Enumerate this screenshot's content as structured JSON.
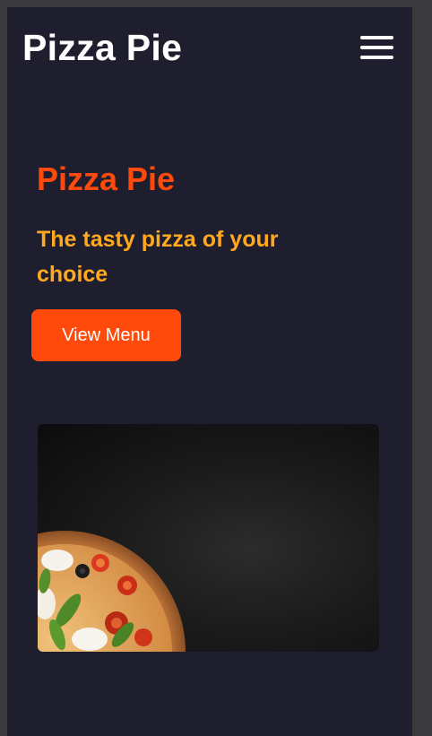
{
  "header": {
    "brand": "Pizza Pie",
    "menu_icon": "hamburger-menu-icon"
  },
  "hero": {
    "title": "Pizza Pie",
    "subtitle": "The tasty pizza of your choice",
    "button_label": "View Menu",
    "image": "pizza-on-chalkboard-image"
  },
  "colors": {
    "background": "#1f1e2e",
    "accent": "#ff4a0c",
    "secondary": "#ffa91f",
    "text": "#ffffff"
  }
}
